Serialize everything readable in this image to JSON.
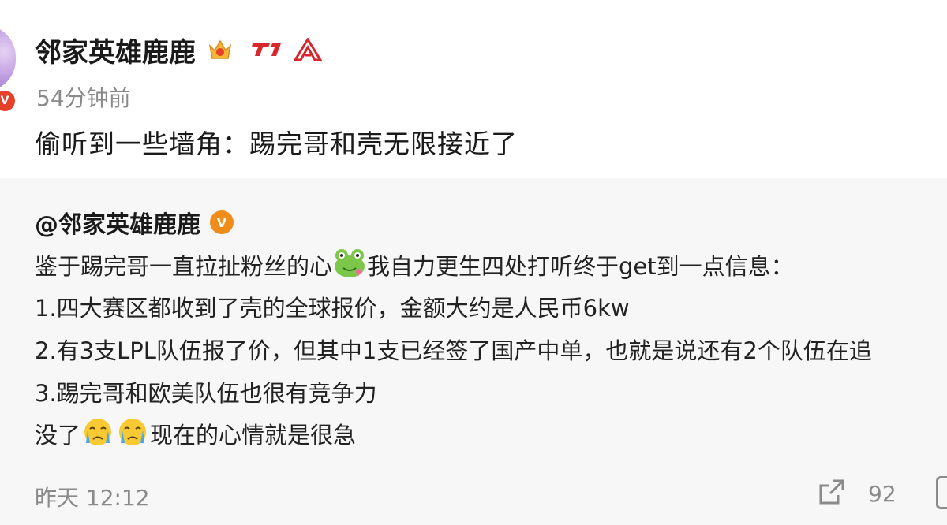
{
  "post": {
    "username": "邻家英雄鹿鹿",
    "time": "54分钟前",
    "text": "偷听到一些墙角：踢完哥和壳无限接近了"
  },
  "repost": {
    "author": "@邻家英雄鹿鹿",
    "line1_a": "鉴于踢完哥一直拉扯粉丝的心",
    "line1_b": "我自力更生四处打听终于get到一点信息：",
    "line2": "1.四大赛区都收到了壳的全球报价，金额大约是人民币6kw",
    "line3": "2.有3支LPL队伍报了价，但其中1支已经签了国产中单，也就是说还有2个队伍在追",
    "line4": "3.踢完哥和欧美队伍也很有竞争力",
    "line5_a": "没了",
    "line5_b": "现在的心情就是很急",
    "footer_time": "昨天 12:12",
    "share_count": "92"
  },
  "icons": {
    "crown": "crown-badge-icon",
    "t1": "t1-team-logo-icon",
    "lol": "league-logo-icon",
    "frog": "frog-emoji-icon",
    "cry": "crying-emoji-icon",
    "share": "share-icon"
  },
  "colors": {
    "accent_red": "#e6402b",
    "verified_orange": "#f08c1a",
    "muted": "#8a8a8a",
    "repost_bg": "#f7f7f7"
  }
}
